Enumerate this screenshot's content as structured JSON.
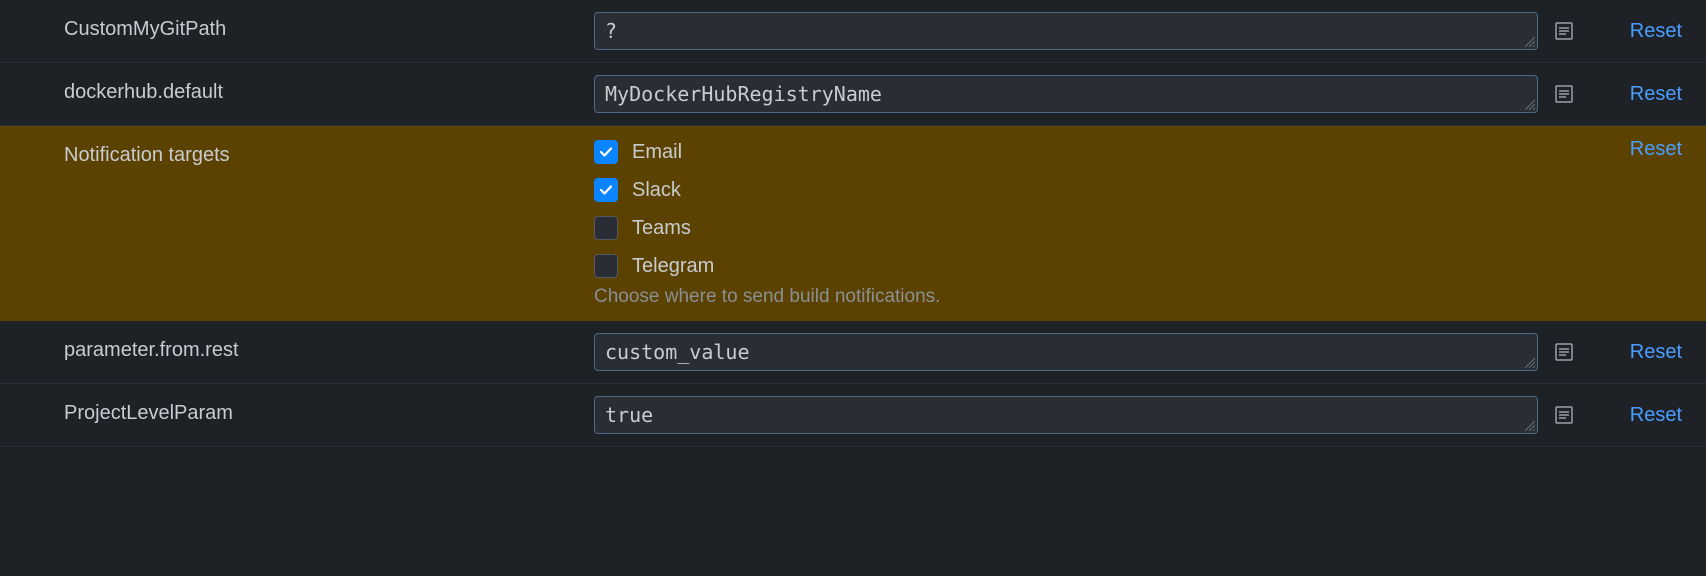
{
  "common": {
    "reset_link": "Reset"
  },
  "rows": {
    "r0": {
      "label": "CustomMyGitPath",
      "value": "?"
    },
    "r1": {
      "label": "dockerhub.default",
      "value": "MyDockerHubRegistryName"
    },
    "r2": {
      "label": "Notification targets",
      "options": {
        "email": {
          "label": "Email",
          "checked": true
        },
        "slack": {
          "label": "Slack",
          "checked": true
        },
        "teams": {
          "label": "Teams",
          "checked": false
        },
        "telegram": {
          "label": "Telegram",
          "checked": false
        }
      },
      "hint": "Choose where to send build notifications."
    },
    "r3": {
      "label": "parameter.from.rest",
      "value": "custom_value"
    },
    "r4": {
      "label": "ProjectLevelParam",
      "value": "true"
    }
  }
}
